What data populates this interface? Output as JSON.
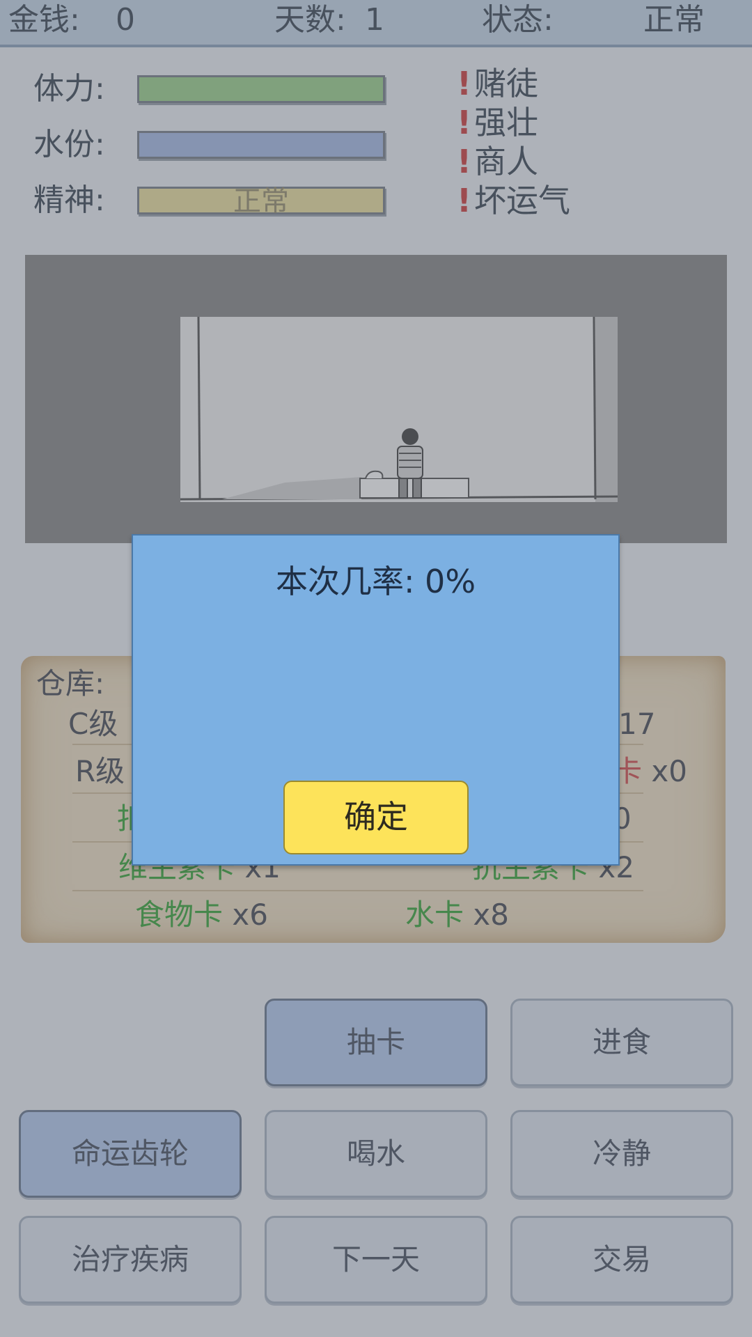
{
  "topbar": {
    "money_label": "金钱:",
    "money_value": "0",
    "days_label": "天数:",
    "days_value": "1",
    "status_label": "状态:",
    "status_value": "正常"
  },
  "stats": {
    "stamina_label": "体力:",
    "water_label": "水份:",
    "spirit_label": "精神:",
    "spirit_text": "正常",
    "stamina_level": 1.0,
    "water_level": 1.0,
    "spirit_level": 1.0
  },
  "traits": [
    "赌徒",
    "强壮",
    "商人",
    "坏运气"
  ],
  "traits_icon": "exclamation-icon",
  "inventory": {
    "title": "仓库:",
    "row1_left": "C级",
    "row1_right": "17",
    "row2_left": "R级",
    "row2_right_card": "卡",
    "row2_right_count": "x0",
    "row3_left": "扣",
    "row3_right": "0",
    "row4_left_name": "维生素卡",
    "row4_left_count": "x1",
    "row4_right_name": "抗生素卡",
    "row4_right_count": "x2",
    "row5_left_name": "食物卡",
    "row5_left_count": "x6",
    "row5_right_name": "水卡",
    "row5_right_count": "x8"
  },
  "buttons": {
    "draw_card": "抽卡",
    "eat": "进食",
    "fate_gear": "命运齿轮",
    "drink": "喝水",
    "calm": "冷静",
    "treat": "治疗疾病",
    "next_day": "下一天",
    "trade": "交易"
  },
  "modal": {
    "title": "本次几率: 0%",
    "confirm": "确定"
  },
  "colors": {
    "stamina_bar": "#9fd48f",
    "water_bar": "#a9bde8",
    "spirit_bar": "#eee2a0",
    "modal_bg": "#7cb0e2",
    "confirm_bg": "#fde35a",
    "active_button": "#b7cdf1"
  }
}
